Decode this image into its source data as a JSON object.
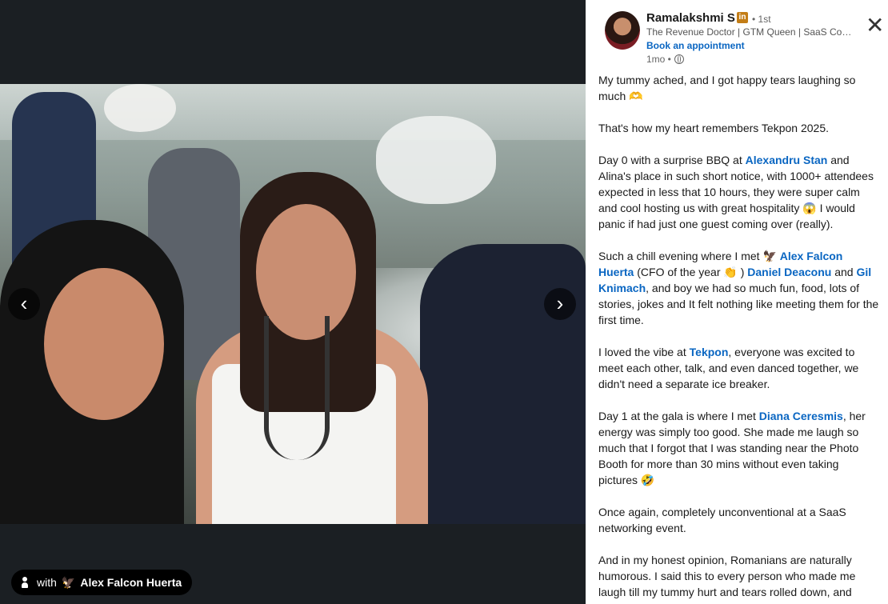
{
  "viewer": {
    "prev_arrow": "‹",
    "next_arrow": "›",
    "tag": {
      "with": "with",
      "emoji": "🦅",
      "name": "Alex Falcon Huerta"
    }
  },
  "post": {
    "author": "Ramalakshmi S",
    "badge": "in",
    "degree": "• 1st",
    "headline": "The Revenue Doctor | GTM Queen | SaaS Coac...",
    "cta": "Book an appointment",
    "time": "1mo •",
    "close": "✕",
    "p1": "My tummy ached, and I got happy tears laughing so much 🫶",
    "p2": "That's how my heart remembers Tekpon 2025.",
    "p3a": "Day 0 with a surprise BBQ at ",
    "p3_mention": "Alexandru Stan",
    "p3b": " and Alina's place in such short notice, with 1000+ attendees expected in less that 10 hours, they were super calm and cool hosting us with great hospitality 😱 I would panic if had just one guest coming over (really).",
    "p4a": "Such a chill evening where I met 🦅 ",
    "p4_mention1": "Alex Falcon Huerta",
    "p4b": " (CFO of the year 👏 ) ",
    "p4_mention2": "Daniel Deaconu",
    "p4c": " and ",
    "p4_mention3": "Gil Knimach",
    "p4d": ", and boy we had so much fun, food, lots of stories, jokes and It felt nothing like meeting them for the first time.",
    "p5a": "I loved the vibe at ",
    "p5_mention": "Tekpon",
    "p5b": ", everyone was excited to meet each other, talk, and even danced together, we didn't need a separate ice breaker.",
    "p6a": "Day 1 at the gala is where I met ",
    "p6_mention": "Diana Ceresmis",
    "p6b": ", her energy was simply too good. She made me laugh so much that I forgot that I was standing near the Photo Booth for more than 30 mins without even taking pictures 🤣",
    "p7": "Once again, completely unconventional at a SaaS networking event.",
    "p8": "And in my honest opinion, Romanians are naturally humorous. I said this to every person who made me laugh till my tummy hurt and tears rolled down, and"
  }
}
